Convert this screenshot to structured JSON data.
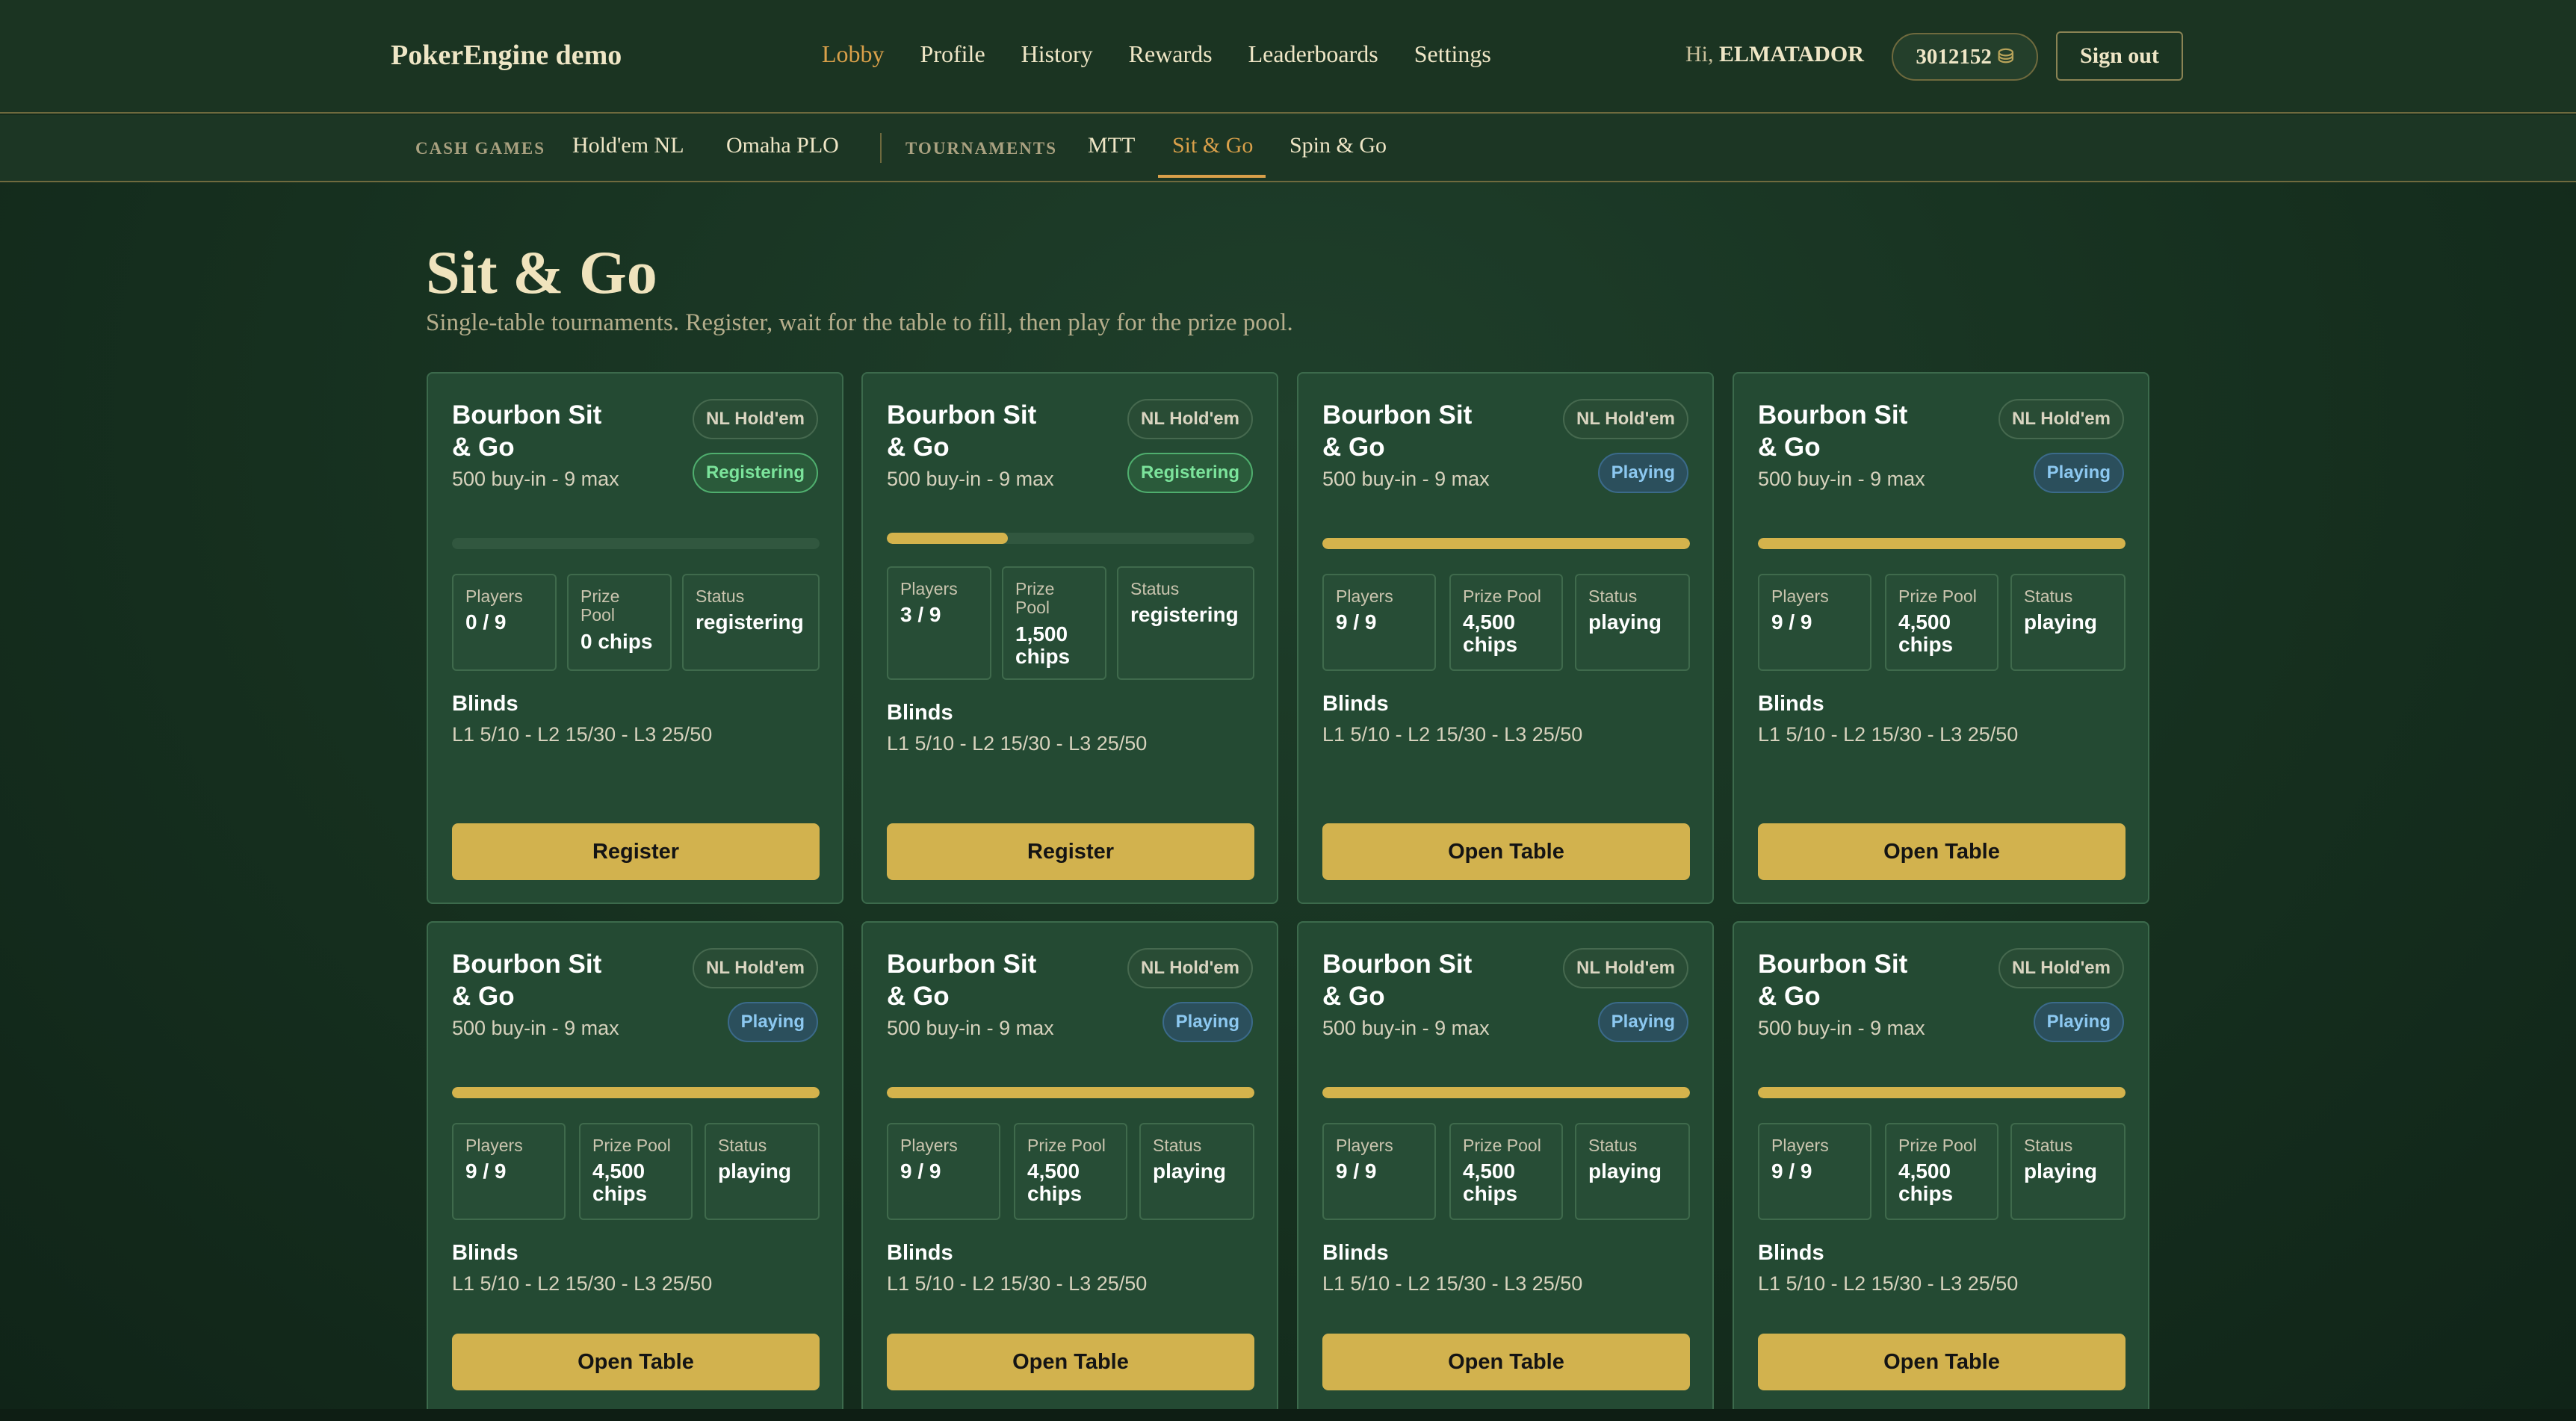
{
  "header": {
    "brand": "PokerEngine demo",
    "nav": [
      "Lobby",
      "Profile",
      "History",
      "Rewards",
      "Leaderboards",
      "Settings"
    ],
    "active_nav": "Lobby",
    "greeting": "Hi,",
    "username": "ELMATADOR",
    "balance": "3012152",
    "coin_icon": "coin-stack-icon",
    "sign_out": "Sign out"
  },
  "subnav": {
    "cash_label": "CASH GAMES",
    "cash_links": [
      "Hold'em NL",
      "Omaha PLO"
    ],
    "tourney_label": "TOURNAMENTS",
    "tourney_links": [
      "MTT",
      "Sit & Go",
      "Spin & Go"
    ],
    "active": "Sit & Go"
  },
  "page": {
    "title": "Sit & Go",
    "subtitle": "Single-table tournaments. Register, wait for the table to fill, then play for the prize pool."
  },
  "colors": {
    "accent": "#d2b24e",
    "active_nav": "#d9a04a",
    "registering": "#7be39b",
    "playing": "#8cc8f0"
  },
  "labels": {
    "players": "Players",
    "prize_pool": "Prize Pool",
    "status": "Status",
    "blinds": "Blinds"
  },
  "cards": [
    {
      "name": "Bourbon Sit & Go",
      "meta": "500 buy-in - 9 max",
      "game": "NL Hold'em",
      "badge": "Registering",
      "players": "0 / 9",
      "fill": 0.0,
      "prize": "0 chips",
      "status": "registering",
      "blinds": "L1 5/10 - L2 15/30 - L3 25/50",
      "action": "Register"
    },
    {
      "name": "Bourbon Sit & Go",
      "meta": "500 buy-in - 9 max",
      "game": "NL Hold'em",
      "badge": "Registering",
      "players": "3 / 9",
      "fill": 0.333,
      "prize": "1,500 chips",
      "status": "registering",
      "blinds": "L1 5/10 - L2 15/30 - L3 25/50",
      "action": "Register"
    },
    {
      "name": "Bourbon Sit & Go",
      "meta": "500 buy-in - 9 max",
      "game": "NL Hold'em",
      "badge": "Playing",
      "players": "9 / 9",
      "fill": 1.0,
      "prize": "4,500 chips",
      "status": "playing",
      "blinds": "L1 5/10 - L2 15/30 - L3 25/50",
      "action": "Open Table"
    },
    {
      "name": "Bourbon Sit & Go",
      "meta": "500 buy-in - 9 max",
      "game": "NL Hold'em",
      "badge": "Playing",
      "players": "9 / 9",
      "fill": 1.0,
      "prize": "4,500 chips",
      "status": "playing",
      "blinds": "L1 5/10 - L2 15/30 - L3 25/50",
      "action": "Open Table"
    },
    {
      "name": "Bourbon Sit & Go",
      "meta": "500 buy-in - 9 max",
      "game": "NL Hold'em",
      "badge": "Playing",
      "players": "9 / 9",
      "fill": 1.0,
      "prize": "4,500 chips",
      "status": "playing",
      "blinds": "L1 5/10 - L2 15/30 - L3 25/50",
      "action": "Open Table"
    },
    {
      "name": "Bourbon Sit & Go",
      "meta": "500 buy-in - 9 max",
      "game": "NL Hold'em",
      "badge": "Playing",
      "players": "9 / 9",
      "fill": 1.0,
      "prize": "4,500 chips",
      "status": "playing",
      "blinds": "L1 5/10 - L2 15/30 - L3 25/50",
      "action": "Open Table"
    },
    {
      "name": "Bourbon Sit & Go",
      "meta": "500 buy-in - 9 max",
      "game": "NL Hold'em",
      "badge": "Playing",
      "players": "9 / 9",
      "fill": 1.0,
      "prize": "4,500 chips",
      "status": "playing",
      "blinds": "L1 5/10 - L2 15/30 - L3 25/50",
      "action": "Open Table"
    },
    {
      "name": "Bourbon Sit & Go",
      "meta": "500 buy-in - 9 max",
      "game": "NL Hold'em",
      "badge": "Playing",
      "players": "9 / 9",
      "fill": 1.0,
      "prize": "4,500 chips",
      "status": "playing",
      "blinds": "L1 5/10 - L2 15/30 - L3 25/50",
      "action": "Open Table"
    }
  ]
}
